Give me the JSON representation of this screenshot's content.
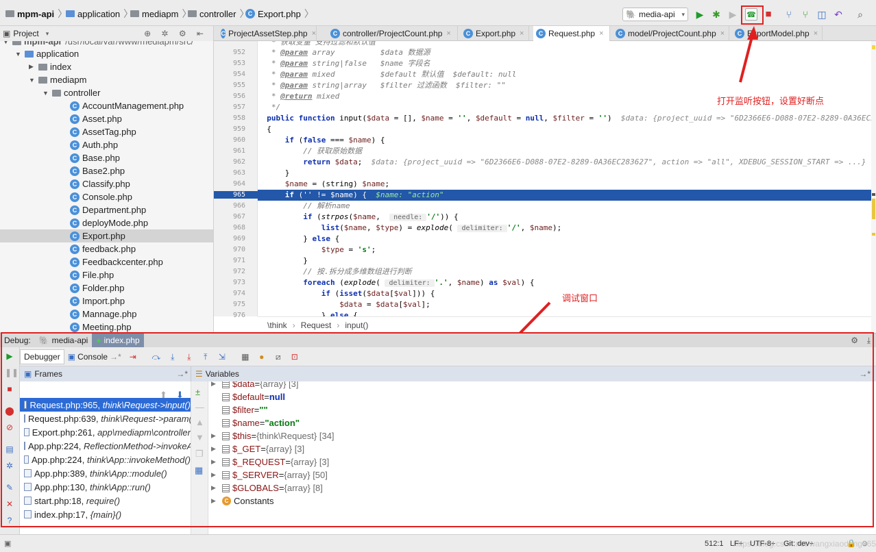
{
  "navbar": {
    "crumbs": [
      "mpm-api",
      "application",
      "mediapm",
      "controller",
      "Export.php"
    ],
    "run_config": "media-api"
  },
  "editor_tabs": [
    {
      "label": "ProjectAssetStep.php"
    },
    {
      "label": "controller/ProjectCount.php"
    },
    {
      "label": "Export.php"
    },
    {
      "label": "Request.php",
      "active": true
    },
    {
      "label": "model/ProjectCount.php"
    },
    {
      "label": "ExportModel.php"
    }
  ],
  "project_panel": {
    "title": "Project",
    "root_label": "mpm-api",
    "root_path": "/usr/local/var/www/mediapm/src/",
    "application": "application",
    "index": "index",
    "mediapm": "mediapm",
    "controller": "controller",
    "files": [
      "AccountManagement.php",
      "Asset.php",
      "AssetTag.php",
      "Auth.php",
      "Base.php",
      "Base2.php",
      "Classify.php",
      "Console.php",
      "Department.php",
      "deployMode.php",
      "Export.php",
      "feedback.php",
      "Feedbackcenter.php",
      "File.php",
      "Folder.php",
      "Import.php",
      "Mannage.php",
      "Meeting.php"
    ],
    "selected_file": "Export.php"
  },
  "code": {
    "line_numbers": [
      "952",
      "953",
      "954",
      "955",
      "956",
      "957",
      "958",
      "959",
      "960",
      "961",
      "962",
      "963",
      "964",
      "965",
      "966",
      "967",
      "968",
      "969",
      "970",
      "971",
      "972",
      "973",
      "974",
      "975",
      "976"
    ],
    "current_line": "965",
    "breadcrumb": [
      "\\think",
      "Request",
      "input()"
    ]
  },
  "annotations": {
    "listen_button_note": "打开监听按钮，设置好断点",
    "debug_window_note": "调试窗口"
  },
  "debug": {
    "title": "Debug:",
    "session_tabs": [
      "media-api",
      "index.php"
    ],
    "tool_tabs": [
      "Debugger",
      "Console"
    ],
    "frames_title": "Frames",
    "variables_title": "Variables",
    "frames": [
      {
        "loc": "Request.php:965,",
        "fn": "think\\Request->input()"
      },
      {
        "loc": "Request.php:639,",
        "fn": "think\\Request->param()"
      },
      {
        "loc": "Export.php:261,",
        "fn": "app\\mediapm\\controller"
      },
      {
        "loc": "App.php:224,",
        "fn": "ReflectionMethod->invokeArgs()"
      },
      {
        "loc": "App.php:224,",
        "fn": "think\\App::invokeMethod()"
      },
      {
        "loc": "App.php:389,",
        "fn": "think\\App::module()"
      },
      {
        "loc": "App.php:130,",
        "fn": "think\\App::run()"
      },
      {
        "loc": "start.php:18,",
        "fn": "require()"
      },
      {
        "loc": "index.php:17,",
        "fn": "{main}()"
      }
    ],
    "variables": [
      {
        "name": "$data",
        "eq": " = ",
        "value": "{array} [3]",
        "kind": "type",
        "expand": true
      },
      {
        "name": "$default",
        "eq": " = ",
        "value": "null",
        "kind": "null",
        "expand": false
      },
      {
        "name": "$filter",
        "eq": " = ",
        "value": "\"\"",
        "kind": "str",
        "expand": false
      },
      {
        "name": "$name",
        "eq": " = ",
        "value": "\"action\"",
        "kind": "str",
        "expand": false
      },
      {
        "name": "$this",
        "eq": " = ",
        "value": "{think\\Request} [34]",
        "kind": "type",
        "expand": true
      },
      {
        "name": "$_GET",
        "eq": " = ",
        "value": "{array} [3]",
        "kind": "type",
        "expand": true
      },
      {
        "name": "$_REQUEST",
        "eq": " = ",
        "value": "{array} [3]",
        "kind": "type",
        "expand": true
      },
      {
        "name": "$_SERVER",
        "eq": " = ",
        "value": "{array} [50]",
        "kind": "type",
        "expand": true
      },
      {
        "name": "$GLOBALS",
        "eq": " = ",
        "value": "{array} [8]",
        "kind": "type",
        "expand": true
      },
      {
        "name": "Constants",
        "eq": "",
        "value": "",
        "kind": "const",
        "expand": true
      }
    ]
  },
  "status": {
    "position": "512:1",
    "line_sep": "LF÷",
    "encoding": "UTF-8÷",
    "vcs": "Git: dev÷",
    "watermark": "https://blog.csdn.net/wangxiaodong365"
  },
  "colors": {
    "accent": "#2257a9",
    "annotation": "#e02020",
    "selection": "#2c6bd6"
  }
}
